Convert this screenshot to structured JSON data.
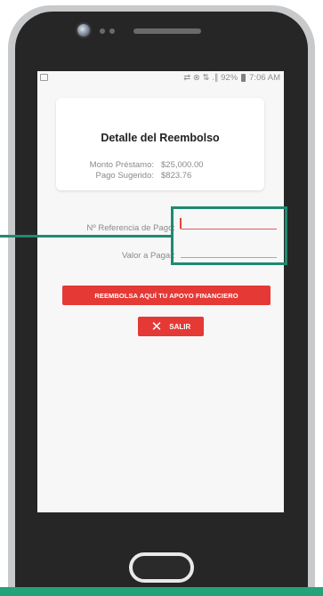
{
  "status_bar": {
    "text": "⇄ ⊗ ⇅ .∥ 92% ",
    "time": "7:06 AM"
  },
  "detail_card": {
    "title": "Detalle del Reembolso",
    "rows": [
      {
        "label": "Monto Préstamo:",
        "value": "$25,000.00"
      },
      {
        "label": "Pago Sugerido:",
        "value": "$823.76"
      }
    ]
  },
  "form": {
    "reference_label": "Nº Referencia de Pago:",
    "reference_value": "",
    "amount_label": "Valor a Pagar:",
    "amount_value": ""
  },
  "buttons": {
    "reembolsa_label": "REEMBOLSA AQUÍ TU APOYO FINANCIERO",
    "salir_label": "SALIR"
  },
  "colors": {
    "accent_red": "#e53935",
    "highlight_green": "#1f8a70"
  },
  "icons": {
    "close": "close-icon",
    "storage": "storage-icon",
    "battery": "battery-icon"
  }
}
